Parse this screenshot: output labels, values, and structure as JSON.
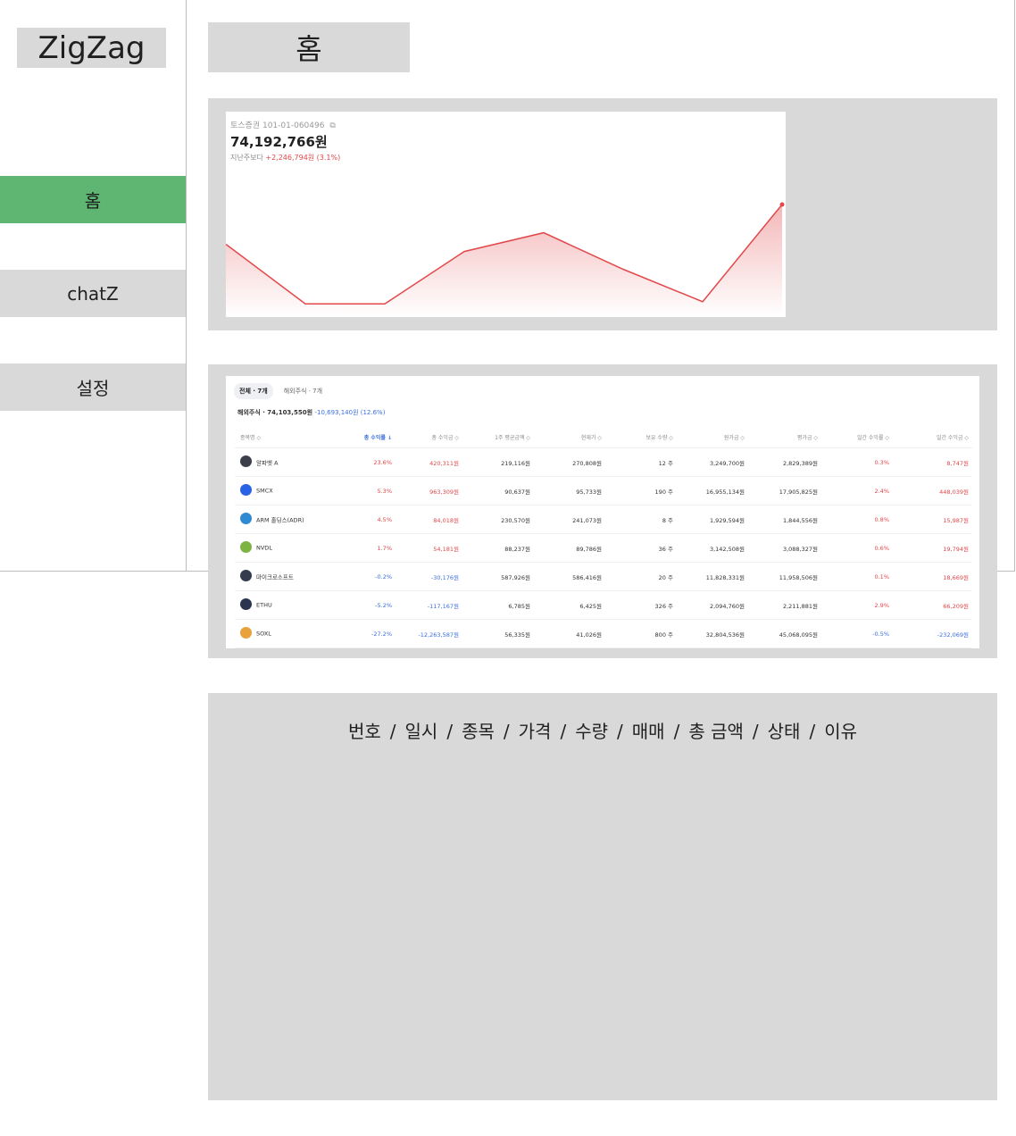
{
  "app": {
    "logo": "ZigZag"
  },
  "sidebar": {
    "items": [
      {
        "label": "홈",
        "active": true
      },
      {
        "label": "chatZ",
        "active": false
      },
      {
        "label": "설정",
        "active": false
      }
    ]
  },
  "header": {
    "title": "홈"
  },
  "account": {
    "label": "토스증권 101-01-060496",
    "total": "74,192,766원",
    "change_prefix": "지난주보다",
    "change_value": "+2,246,794원 (3.1%)"
  },
  "colors": {
    "accent_green": "#5fb673",
    "panel_gray": "#d9d9d9",
    "gain_red": "#e2484a",
    "loss_blue": "#3b6fe0"
  },
  "chart_data": {
    "type": "area",
    "x": [
      0,
      1,
      2,
      3,
      4,
      5,
      6,
      7
    ],
    "values": [
      0.62,
      0.05,
      0.05,
      0.55,
      0.73,
      0.38,
      0.07,
      1.0
    ],
    "color": "#e2484a",
    "grid": false,
    "title": "",
    "xlabel": "",
    "ylabel": ""
  },
  "holdings": {
    "tabs": [
      {
        "label": "전체 · 7개",
        "active": true
      },
      {
        "label": "해외주식 · 7개",
        "active": false
      }
    ],
    "summary_label": "해외주식 · 74,103,550원",
    "summary_change": "-10,693,140원 (12.6%)",
    "columns": [
      "종목명 ◇",
      "총 수익률 ↓",
      "총 수익금 ◇",
      "1주 평균금액 ◇",
      "현재가 ◇",
      "보유 수량 ◇",
      "원가금 ◇",
      "평가금 ◇",
      "일간 수익률 ◇",
      "일간 수익금 ◇"
    ],
    "rows": [
      {
        "name": "알파벳 A",
        "logo_color": "#3b3f4a",
        "cells": [
          "23.6%",
          "420,311원",
          "219,116원",
          "270,808원",
          "12 주",
          "3,249,700원",
          "2,829,389원",
          "0.3%",
          "8,747원"
        ],
        "tone": [
          "red",
          "red",
          "",
          "",
          "",
          "",
          "",
          "red",
          "red"
        ]
      },
      {
        "name": "SMCX",
        "logo_color": "#2a62e6",
        "cells": [
          "5.3%",
          "963,309원",
          "90,637원",
          "95,733원",
          "190 주",
          "16,955,134원",
          "17,905,825원",
          "2.4%",
          "448,039원"
        ],
        "tone": [
          "red",
          "red",
          "",
          "",
          "",
          "",
          "",
          "red",
          "red"
        ]
      },
      {
        "name": "ARM 홀딩스(ADR)",
        "logo_color": "#2f8ad1",
        "cells": [
          "4.5%",
          "84,018원",
          "230,570원",
          "241,073원",
          "8 주",
          "1,929,594원",
          "1,844,556원",
          "0.8%",
          "15,987원"
        ],
        "tone": [
          "red",
          "red",
          "",
          "",
          "",
          "",
          "",
          "red",
          "red"
        ]
      },
      {
        "name": "NVDL",
        "logo_color": "#7cb342",
        "cells": [
          "1.7%",
          "54,181원",
          "88,237원",
          "89,786원",
          "36 주",
          "3,142,508원",
          "3,088,327원",
          "0.6%",
          "19,794원"
        ],
        "tone": [
          "red",
          "red",
          "",
          "",
          "",
          "",
          "",
          "red",
          "red"
        ]
      },
      {
        "name": "마이크로소프트",
        "logo_color": "#333b4d",
        "cells": [
          "-0.2%",
          "-30,176원",
          "587,926원",
          "586,416원",
          "20 주",
          "11,828,331원",
          "11,958,506원",
          "0.1%",
          "18,669원"
        ],
        "tone": [
          "blue",
          "blue",
          "",
          "",
          "",
          "",
          "",
          "red",
          "red"
        ]
      },
      {
        "name": "ETHU",
        "logo_color": "#2b3550",
        "cells": [
          "-5.2%",
          "-117,167원",
          "6,785원",
          "6,425원",
          "326 주",
          "2,094,760원",
          "2,211,881원",
          "2.9%",
          "66,209원"
        ],
        "tone": [
          "blue",
          "blue",
          "",
          "",
          "",
          "",
          "",
          "red",
          "red"
        ]
      },
      {
        "name": "SOXL",
        "logo_color": "#e9a23b",
        "cells": [
          "-27.2%",
          "-12,263,587원",
          "56,335원",
          "41,026원",
          "800 주",
          "32,804,536원",
          "45,068,095원",
          "-0.5%",
          "-232,069원"
        ],
        "tone": [
          "blue",
          "blue",
          "",
          "",
          "",
          "",
          "",
          "blue",
          "blue"
        ]
      }
    ]
  },
  "history": {
    "columns": [
      "번호",
      "일시",
      "종목",
      "가격",
      "수량",
      "매매",
      "총 금액",
      "상태",
      "이유"
    ]
  }
}
